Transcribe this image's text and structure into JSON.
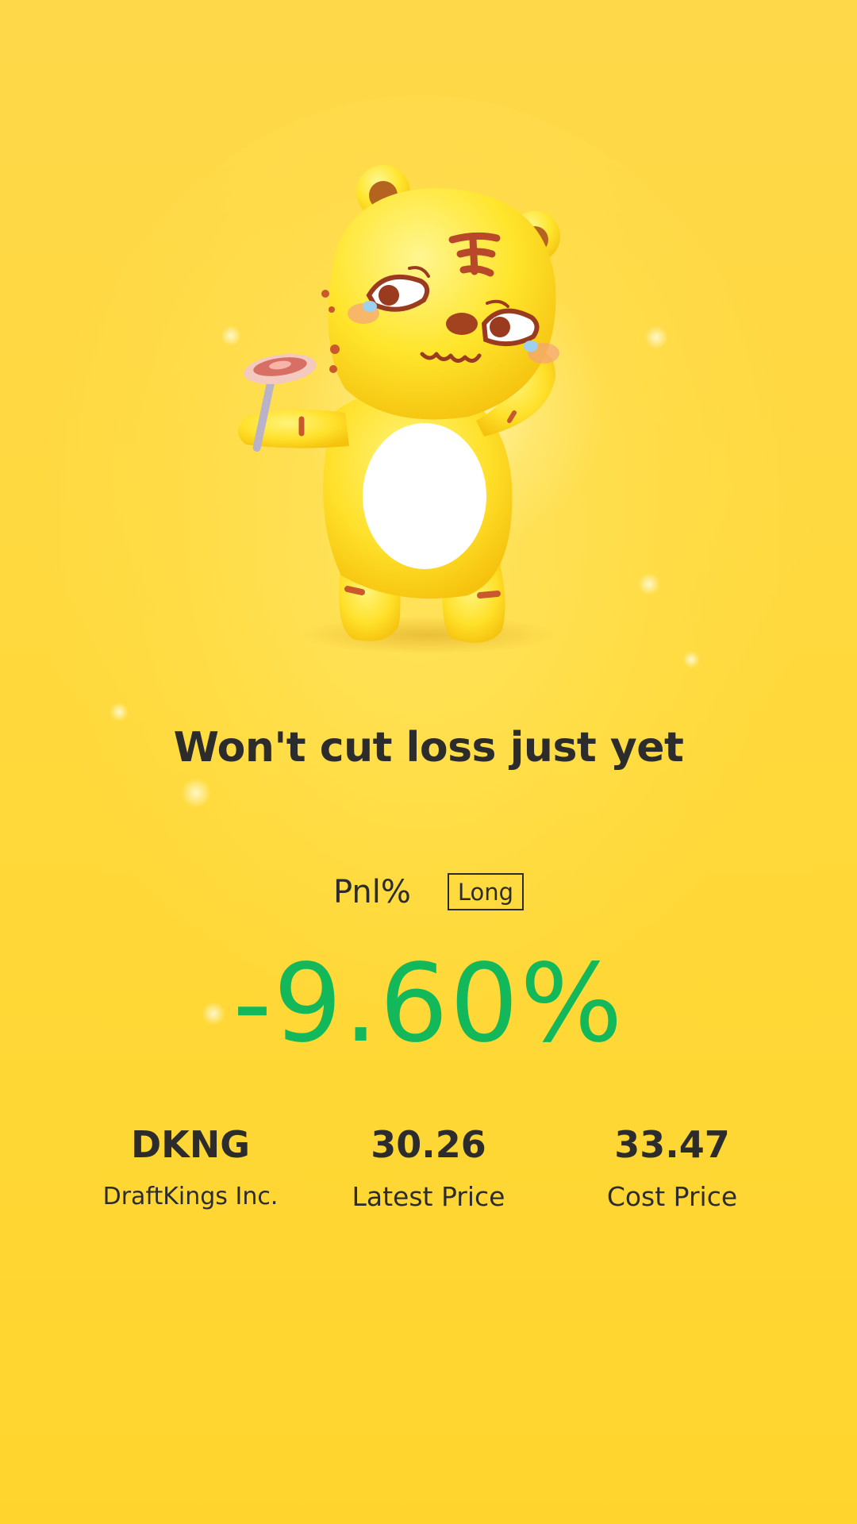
{
  "mascot": {
    "icon": "tiger-mascot-holding-meat-icon"
  },
  "headline": "Won't cut loss just yet",
  "pnl": {
    "label": "Pnl%",
    "side": "Long",
    "value": "-9.60%",
    "value_color": "#12b85a"
  },
  "stats": {
    "symbol": "DKNG",
    "company": "DraftKings Inc.",
    "latest_price": "30.26",
    "latest_price_label": "Latest Price",
    "cost_price": "33.47",
    "cost_price_label": "Cost Price"
  },
  "colors": {
    "background": "#ffd93c",
    "text": "#2c2c2c",
    "loss": "#12b85a"
  }
}
